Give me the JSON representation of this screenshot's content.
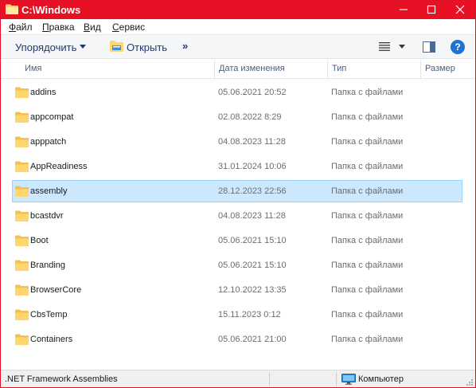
{
  "window": {
    "title": "C:\\Windows",
    "accent_color": "#e81123"
  },
  "menu": {
    "file": {
      "prefix": "",
      "accel": "Ф",
      "rest": "айл"
    },
    "edit": {
      "prefix": "",
      "accel": "П",
      "rest": "равка"
    },
    "view": {
      "prefix": "",
      "accel": "В",
      "rest": "ид"
    },
    "tools": {
      "prefix": "",
      "accel": "С",
      "rest": "ервис"
    }
  },
  "toolbar": {
    "organize_label": "Упорядочить",
    "open_label": "Открыть",
    "more_label": "»",
    "help_label": "?"
  },
  "columns": {
    "name": "Имя",
    "date": "Дата изменения",
    "type": "Тип",
    "size": "Размер"
  },
  "files": [
    {
      "name": "addins",
      "date": "05.06.2021 20:52",
      "type": "Папка с файлами",
      "selected": false
    },
    {
      "name": "appcompat",
      "date": "02.08.2022 8:29",
      "type": "Папка с файлами",
      "selected": false
    },
    {
      "name": "apppatch",
      "date": "04.08.2023 11:28",
      "type": "Папка с файлами",
      "selected": false
    },
    {
      "name": "AppReadiness",
      "date": "31.01.2024 10:06",
      "type": "Папка с файлами",
      "selected": false
    },
    {
      "name": "assembly",
      "date": "28.12.2023 22:56",
      "type": "Папка с файлами",
      "selected": true
    },
    {
      "name": "bcastdvr",
      "date": "04.08.2023 11:28",
      "type": "Папка с файлами",
      "selected": false
    },
    {
      "name": "Boot",
      "date": "05.06.2021 15:10",
      "type": "Папка с файлами",
      "selected": false
    },
    {
      "name": "Branding",
      "date": "05.06.2021 15:10",
      "type": "Папка с файлами",
      "selected": false
    },
    {
      "name": "BrowserCore",
      "date": "12.10.2022 13:35",
      "type": "Папка с файлами",
      "selected": false
    },
    {
      "name": "CbsTemp",
      "date": "15.11.2023 0:12",
      "type": "Папка с файлами",
      "selected": false
    },
    {
      "name": "Containers",
      "date": "05.06.2021 21:00",
      "type": "Папка с файлами",
      "selected": false
    }
  ],
  "status": {
    "left": ".NET Framework Assemblies",
    "right": "Компьютер"
  },
  "icons": {
    "title": "folder-icon",
    "minimize": "minimize-icon",
    "maximize": "maximize-icon",
    "close": "close-icon",
    "views": "details-view-icon",
    "pane": "preview-pane-icon",
    "help": "help-icon",
    "computer": "computer-icon"
  }
}
